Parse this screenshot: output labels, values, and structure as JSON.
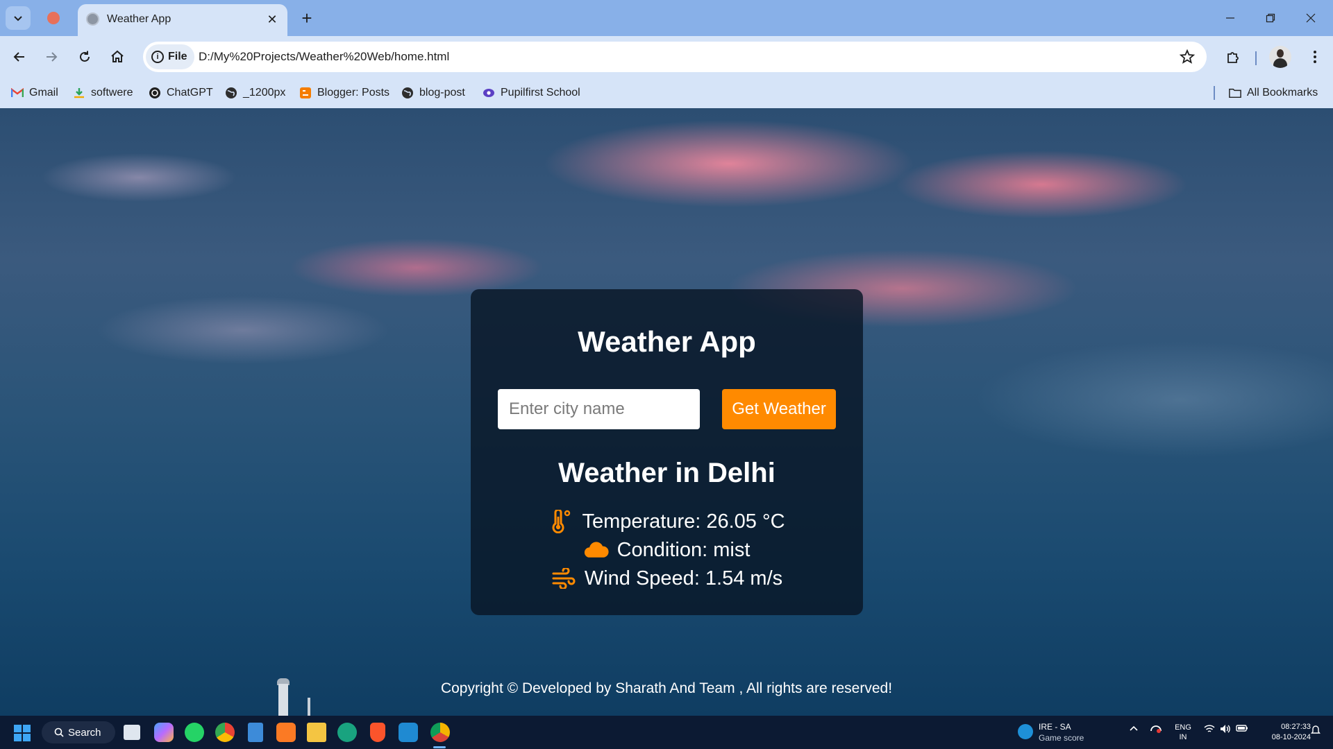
{
  "browser": {
    "tab": {
      "title": "Weather App"
    },
    "address": {
      "scheme_chip": "File",
      "url": "D:/My%20Projects/Weather%20Web/home.html"
    },
    "bookmarks": [
      {
        "label": "Gmail",
        "icon": "gmail-icon"
      },
      {
        "label": "softwere",
        "icon": "download-icon"
      },
      {
        "label": "ChatGPT",
        "icon": "chatgpt-icon"
      },
      {
        "label": "_1200px",
        "icon": "globe-icon"
      },
      {
        "label": "Blogger: Posts",
        "icon": "blogger-icon"
      },
      {
        "label": "blog-post",
        "icon": "globe-icon"
      },
      {
        "label": "Pupilfirst School",
        "icon": "pupilfirst-icon"
      }
    ],
    "all_bookmarks_label": "All Bookmarks"
  },
  "app": {
    "title": "Weather App",
    "search": {
      "placeholder": "Enter city name",
      "value": ""
    },
    "button_label": "Get Weather",
    "result": {
      "heading": "Weather in Delhi",
      "temperature": "Temperature: 26.05 °C",
      "condition": "Condition: mist",
      "wind": "Wind Speed: 1.54 m/s"
    },
    "footer": "Copyright © Developed by Sharath And Team , All rights are reserved!",
    "accent_color": "#ff8a00"
  },
  "taskbar": {
    "search_label": "Search",
    "widget": {
      "line1": "IRE - SA",
      "line2": "Game score"
    },
    "language": {
      "line1": "ENG",
      "line2": "IN"
    },
    "clock": {
      "time": "08:27:33",
      "date": "08-10-2024"
    },
    "apps": [
      "task-view-icon",
      "copilot-icon",
      "whatsapp-icon",
      "chrome-icon",
      "notepad-icon",
      "xampp-icon",
      "file-explorer-icon",
      "chatgpt-icon",
      "brave-icon",
      "vscode-icon",
      "chrome-canary-icon"
    ]
  }
}
